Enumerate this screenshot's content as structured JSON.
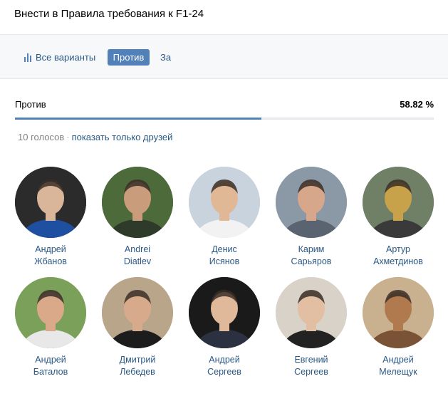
{
  "poll": {
    "title": "Внести в Правила требования к F1-24"
  },
  "tabs": {
    "all_label": "Все варианты",
    "against_label": "Против",
    "for_label": "За"
  },
  "result": {
    "option_label": "Против",
    "percent_label": "58.82 %",
    "progress_fraction": 0.5882
  },
  "votes": {
    "count_label": "10 голосов",
    "separator": "·",
    "friends_link": "показать только друзей"
  },
  "voters": [
    {
      "first": "Андрей",
      "last": "Жбанов",
      "bg": "#2b2b2b",
      "skin": "#d9b59a",
      "shirt": "#1f4fa0"
    },
    {
      "first": "Andrei",
      "last": "Diatlev",
      "bg": "#4d6b3a",
      "skin": "#c99d7c",
      "shirt": "#2e3a2a"
    },
    {
      "first": "Денис",
      "last": "Исянов",
      "bg": "#c9d3de",
      "skin": "#e0b896",
      "shirt": "#f2f2f2"
    },
    {
      "first": "Карим",
      "last": "Сарьяров",
      "bg": "#8b98a6",
      "skin": "#d6a78a",
      "shirt": "#5a6470"
    },
    {
      "first": "Артур",
      "last": "Ахметдинов",
      "bg": "#6f8066",
      "skin": "#c8a24a",
      "shirt": "#3a3a3a"
    },
    {
      "first": "Андрей",
      "last": "Баталов",
      "bg": "#7aa05a",
      "skin": "#d9a98a",
      "shirt": "#e8e8e8"
    },
    {
      "first": "Дмитрий",
      "last": "Лебедев",
      "bg": "#b8a58a",
      "skin": "#d6aa8a",
      "shirt": "#1c1c1c"
    },
    {
      "first": "Андрей",
      "last": "Сергеев",
      "bg": "#1a1a1a",
      "skin": "#e0b89a",
      "shirt": "#2b3140"
    },
    {
      "first": "Евгений",
      "last": "Сергеев",
      "bg": "#d8d2c8",
      "skin": "#e2bfa2",
      "shirt": "#222222"
    },
    {
      "first": "Андрей",
      "last": "Мелещук",
      "bg": "#c9b08e",
      "skin": "#b07a4e",
      "shirt": "#7a5236"
    }
  ]
}
